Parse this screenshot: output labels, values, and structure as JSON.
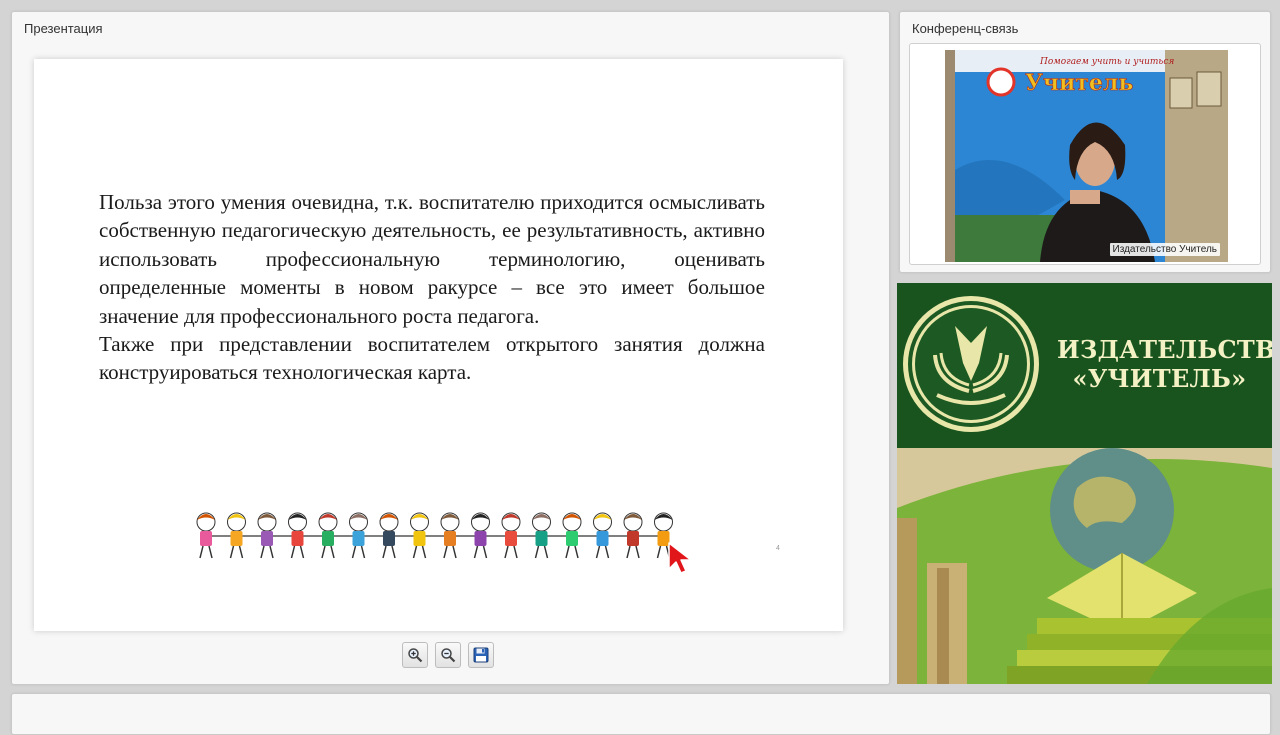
{
  "presentation": {
    "title": "Презентация",
    "slide": {
      "paragraphs": [
        "Польза этого умения очевидна, т.к. воспитателю приходится осмысливать собственную педагогическую деятельность, ее результативность, активно использовать профессиональную терминологию, оценивать определенные моменты в новом ракурсе – все это имеет большое значение для профессионального роста педагога.",
        "Также при представлении воспитателем открытого занятия должна конструироваться технологическая карта."
      ],
      "page_marker": "4"
    },
    "toolbar": [
      {
        "name": "zoom-in-button",
        "icon": "zoom-in-icon"
      },
      {
        "name": "zoom-out-button",
        "icon": "zoom-out-icon"
      },
      {
        "name": "save-button",
        "icon": "floppy-disk-icon"
      }
    ]
  },
  "conference": {
    "title": "Конференц-связь",
    "video": {
      "participant_label": "Издательство Учитель",
      "backdrop_tagline": "Помогаем учить и учиться",
      "backdrop_brand": "Учитель"
    }
  },
  "banner": {
    "line1": "ИЗДАТЕЛЬСТВО",
    "line2": "«УЧИТЕЛЬ»",
    "colors": {
      "dark_green": "#19541f",
      "gold": "#e8e6a8"
    }
  }
}
